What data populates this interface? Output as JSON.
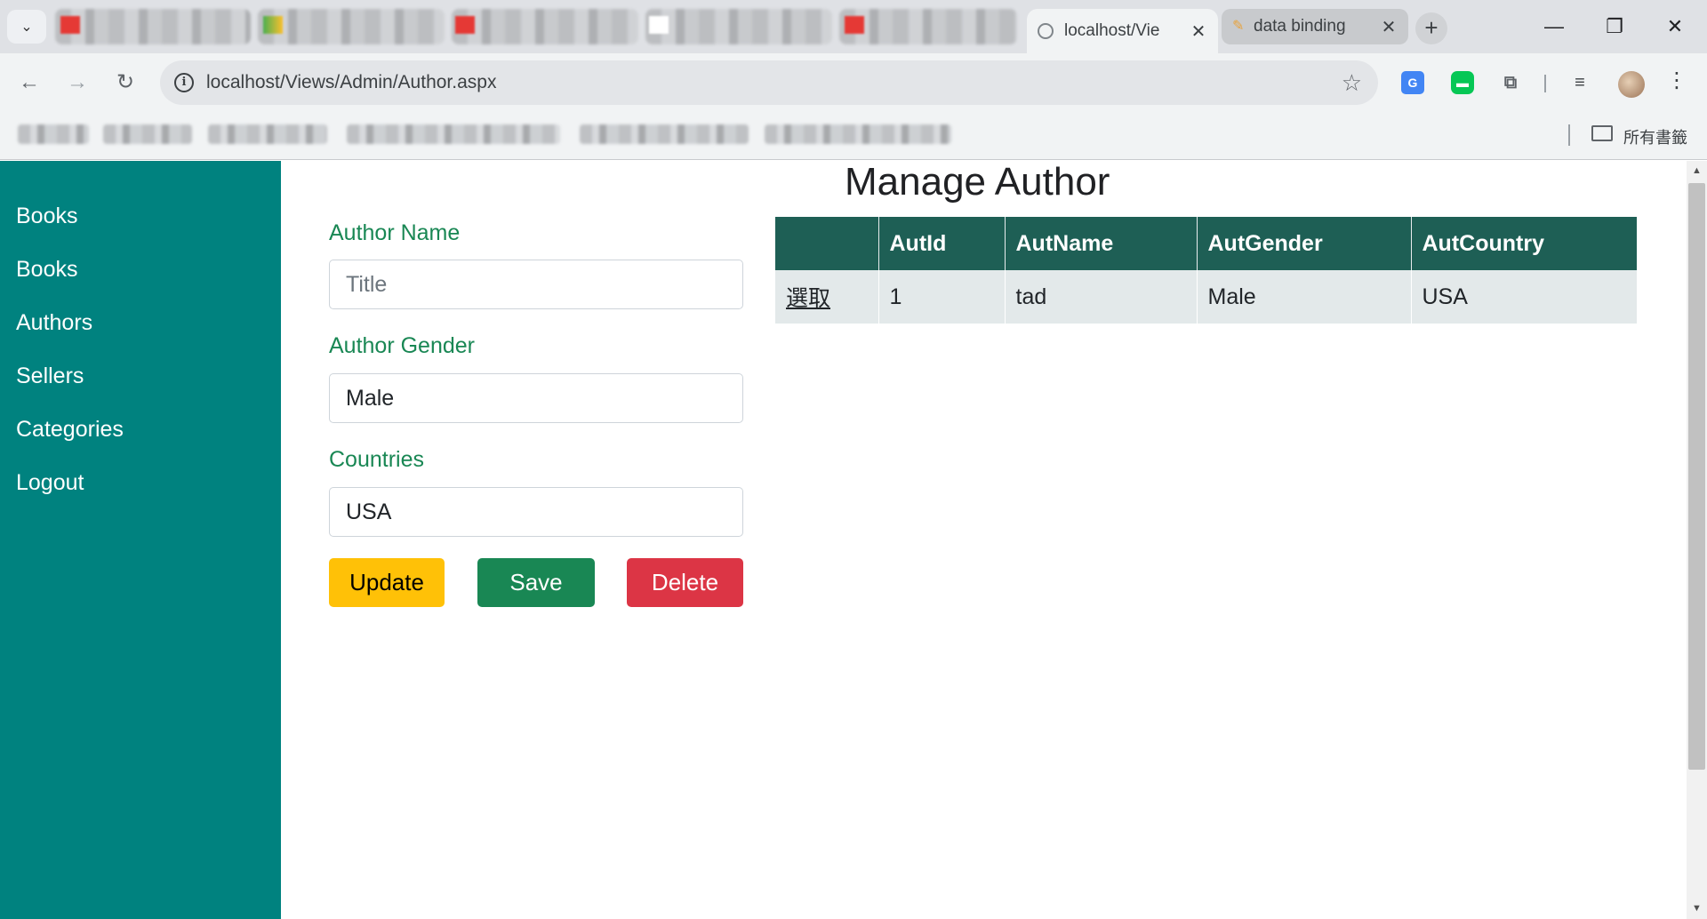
{
  "browser": {
    "tabs": [
      {
        "title": "localhost/Vie",
        "close": "✕",
        "active": true
      },
      {
        "title": "data binding",
        "close": "✕",
        "active": false
      }
    ],
    "new_tab": "+",
    "window_controls": {
      "minimize": "—",
      "restore": "❐",
      "close": "✕"
    },
    "url": "localhost/Views/Admin/Author.aspx",
    "all_bookmarks_label": "所有書籤"
  },
  "sidebar": {
    "items": [
      {
        "label": "Books"
      },
      {
        "label": "Books"
      },
      {
        "label": "Authors"
      },
      {
        "label": "Sellers"
      },
      {
        "label": "Categories"
      },
      {
        "label": "Logout"
      }
    ]
  },
  "main": {
    "title": "Manage Author",
    "form": {
      "author_name_label": "Author Name",
      "author_name_value": "",
      "author_name_placeholder": "Title",
      "author_gender_label": "Author Gender",
      "author_gender_value": "Male",
      "countries_label": "Countries",
      "countries_value": "USA"
    },
    "buttons": {
      "update": "Update",
      "save": "Save",
      "delete": "Delete"
    },
    "table": {
      "columns": [
        "",
        "AutId",
        "AutName",
        "AutGender",
        "AutCountry"
      ],
      "rows": [
        {
          "select": "選取",
          "AutId": "1",
          "AutName": "tad",
          "AutGender": "Male",
          "AutCountry": "USA"
        }
      ]
    }
  },
  "colors": {
    "sidebar": "#00827f",
    "label_green": "#198754",
    "header_green": "#1e5f55",
    "update_yellow": "#ffc107",
    "save_green": "#198754",
    "delete_red": "#dc3545"
  },
  "icons": {
    "tab_search": "chevron-down-icon",
    "back": "arrow-left-icon",
    "forward": "arrow-right-icon",
    "reload": "reload-icon",
    "site_info": "info-icon",
    "bookmark": "star-icon",
    "translate": "translate-icon",
    "line": "line-app-icon",
    "extensions": "puzzle-icon",
    "media": "media-control-icon",
    "profile": "avatar",
    "menu": "more-vert-icon",
    "folder": "folder-icon"
  }
}
